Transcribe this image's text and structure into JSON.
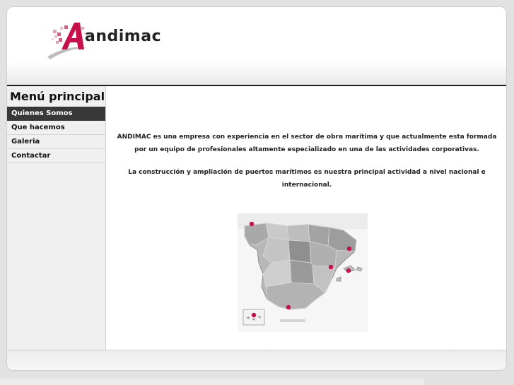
{
  "brand": {
    "logo_text": "andimac"
  },
  "sidebar": {
    "title": "Menú principal",
    "items": [
      {
        "label": "Quienes Somos",
        "active": true
      },
      {
        "label": "Que hacemos",
        "active": false
      },
      {
        "label": "Galeria",
        "active": false
      },
      {
        "label": "Contactar",
        "active": false
      }
    ]
  },
  "content": {
    "paragraph_1": "ANDIMAC  es una empresa con experiencia en el sector de obra marítima y que actualmente esta formada por un equipo de profesionales altamente especializado en una de las actividades corporativas.",
    "paragraph_2": "La construcción y ampliación de puertos marítimos es nuestra principal actividad a nivel nacional e internacional."
  },
  "colors": {
    "accent": "#c8104a",
    "menu_active_bg": "#383838",
    "header_rule": "#1f1f1f"
  }
}
